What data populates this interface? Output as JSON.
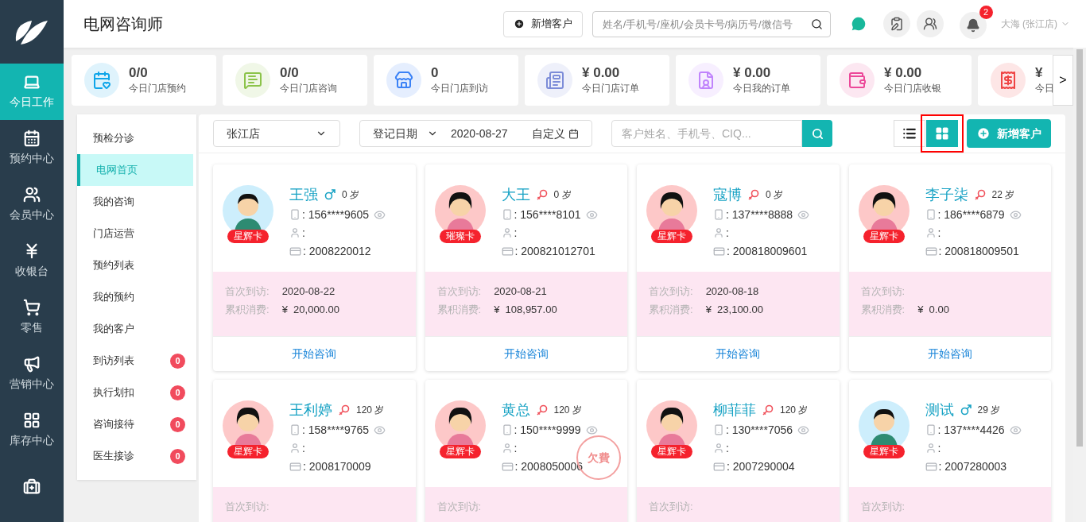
{
  "header": {
    "title": "电网咨询师",
    "add_button": "新增客户",
    "search": {
      "placeholder": "姓名/手机号/座机/会员卡号/病历号/微信号"
    },
    "notifications": "2",
    "user": "大海 (张江店)"
  },
  "nav": [
    {
      "label": "今日工作",
      "selected": true
    },
    {
      "label": "预约中心",
      "selected": false
    },
    {
      "label": "会员中心",
      "selected": false
    },
    {
      "label": "收银台",
      "selected": false
    },
    {
      "label": "零售",
      "selected": false
    },
    {
      "label": "营销中心",
      "selected": false
    },
    {
      "label": "库存中心",
      "selected": false
    },
    {
      "selected": false
    }
  ],
  "stats": [
    {
      "value": "0/0",
      "label": "今日门店预约",
      "color": "#0ea5e9"
    },
    {
      "value": "0/0",
      "label": "今日门店咨询",
      "color": "#8bc34a"
    },
    {
      "value": "0",
      "label": "今日门店到访",
      "color": "#3b82f6"
    },
    {
      "value": "¥ 0.00",
      "label": "今日门店订单",
      "color": "#7c8cd8"
    },
    {
      "value": "¥ 0.00",
      "label": "今日我的订单",
      "color": "#c084fc"
    },
    {
      "value": "¥ 0.00",
      "label": "今日门店收银",
      "color": "#ec4899"
    },
    {
      "value": "¥",
      "label": "今日",
      "color": "#ef4444"
    }
  ],
  "stats_next": ">",
  "submenu": [
    {
      "label": "预检分诊",
      "selected": false
    },
    {
      "label": "电网首页",
      "selected": true
    },
    {
      "label": "我的咨询",
      "selected": false
    },
    {
      "label": "门店运营",
      "selected": false
    },
    {
      "label": "预约列表",
      "selected": false
    },
    {
      "label": "我的预约",
      "selected": false
    },
    {
      "label": "我的客户",
      "selected": false
    },
    {
      "label": "到访列表",
      "selected": false,
      "badge": "0"
    },
    {
      "label": "执行划扣",
      "selected": false,
      "badge": "0"
    },
    {
      "label": "咨询接待",
      "selected": false,
      "badge": "0"
    },
    {
      "label": "医生接诊",
      "selected": false,
      "badge": "0"
    }
  ],
  "toolbar": {
    "store": "张江店",
    "date_type": "登记日期",
    "date": "2020-08-27",
    "custom": "自定义",
    "search": {
      "placeholder": "客户姓名、手机号、CIQ..."
    },
    "views": [
      {
        "kind": "list",
        "selected": false
      },
      {
        "kind": "grid",
        "selected": true
      }
    ],
    "add_button": "新增客户"
  },
  "cards": [
    {
      "name": "王强",
      "kind": "male",
      "age": "0 岁",
      "card": "星辉卡",
      "phone": ": 156****9605",
      "staff": ":",
      "vip": ": 2008220012",
      "stats": [
        {
          "label": "首次到访:",
          "value": "2020-08-22"
        },
        {
          "label": "累积消费:",
          "value": "¥  20,000.00"
        }
      ],
      "action": "开始咨询"
    },
    {
      "name": "大王",
      "kind": "female",
      "age": "0 岁",
      "card": "璀璨卡",
      "phone": ": 156****8101",
      "staff": ":",
      "vip": ": 200821012701",
      "stats": [
        {
          "label": "首次到访:",
          "value": "2020-08-21"
        },
        {
          "label": "累积消费:",
          "value": "¥  108,957.00"
        }
      ],
      "action": "开始咨询"
    },
    {
      "name": "寇博",
      "kind": "female",
      "age": "0 岁",
      "card": "星辉卡",
      "phone": ": 137****8888",
      "staff": ":",
      "vip": ": 200818009601",
      "stats": [
        {
          "label": "首次到访:",
          "value": "2020-08-18"
        },
        {
          "label": "累积消费:",
          "value": "¥  23,100.00"
        }
      ],
      "action": "开始咨询"
    },
    {
      "name": "李子柒",
      "kind": "female",
      "age": "22 岁",
      "card": "星辉卡",
      "phone": ": 186****6879",
      "staff": ":",
      "vip": ": 200818009501",
      "stats": [
        {
          "label": "首次到访:"
        },
        {
          "label": "累积消费:",
          "value": "¥  0.00"
        }
      ],
      "action": "开始咨询"
    },
    {
      "name": "王利婷",
      "kind": "female",
      "age": "120 岁",
      "card": "星辉卡",
      "phone": ": 158****9765",
      "staff": ":",
      "vip": ": 2008170009",
      "stats": [
        {
          "label": "首次到访:"
        }
      ]
    },
    {
      "name": "黄总",
      "kind": "female",
      "age": "120 岁",
      "card": "星辉卡",
      "phone": ": 150****9999",
      "staff": ":",
      "vip": ": 2008050006",
      "stamp": "欠費",
      "stats": [
        {
          "label": "首次到访:"
        }
      ]
    },
    {
      "name": "柳菲菲",
      "kind": "female",
      "age": "120 岁",
      "card": "星辉卡",
      "phone": ": 130****7056",
      "staff": ":",
      "vip": ": 2007290004",
      "stats": [
        {
          "label": "首次到访:"
        }
      ]
    },
    {
      "name": "测试",
      "kind": "male",
      "age": "29 岁",
      "card": "星辉卡",
      "phone": ": 137****4426",
      "staff": ":",
      "vip": ": 2007280003",
      "stats": [
        {
          "label": "首次到访:"
        }
      ]
    }
  ]
}
